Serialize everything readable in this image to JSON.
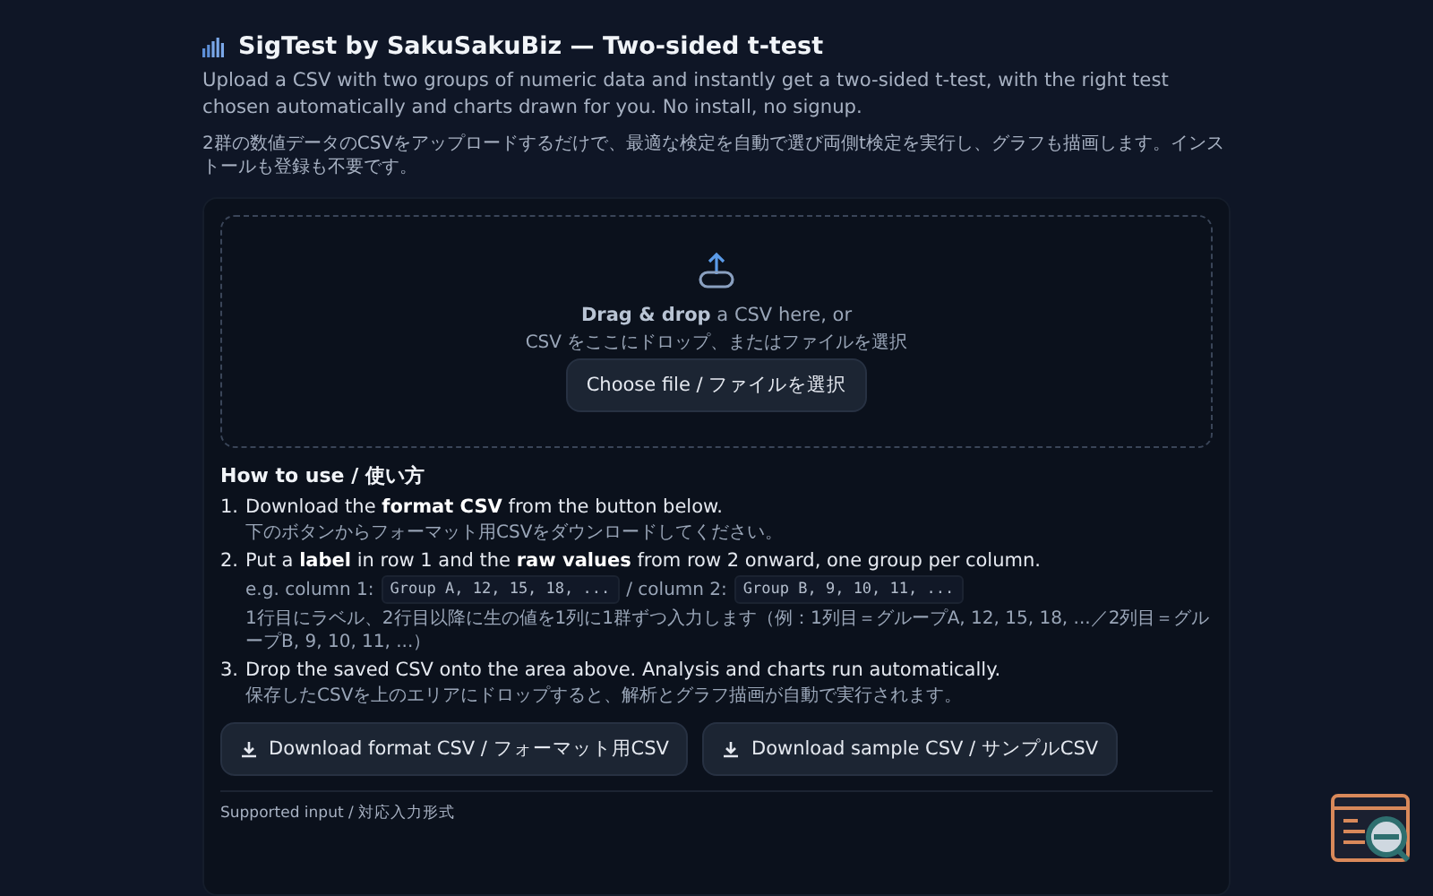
{
  "header": {
    "title": "SigTest by SakuSakuBiz — Two-sided t-test",
    "description": "Upload a CSV with two groups of numeric data and instantly get a two-sided t-test, with the right test chosen automatically and charts drawn for you. No install, no signup.",
    "description_ja": "2群の数値データのCSVをアップロードするだけで、最適な検定を自動で選び両側t検定を実行し、グラフも描画します。インストールも登録も不要です。"
  },
  "dropzone": {
    "prompt": "**Drag & drop** a CSV here, or",
    "prompt_ja": "CSV をここにドロップ、またはファイルを選択",
    "button": "Choose file / ファイルを選択"
  },
  "how_to": {
    "title": "How to use / 使い方",
    "steps": [
      {
        "number": "1.",
        "text": "Download the **format CSV** from the button below.",
        "note": "下のボタンからフォーマット用CSVをダウンロードしてください。"
      },
      {
        "number": "2.",
        "text": "Put a **label** in row 1 and the **raw values** from row 2 onward, one group per column.",
        "example": [
          {
            "label": "e.g. column 1:",
            "code": "Group A, 12, 15, 18, ..."
          },
          {
            "label": "/ column 2:",
            "code": "Group B, 9, 10, 11, ..."
          }
        ],
        "note": "1行目にラベル、2行目以降に生の値を1列に1群ずつ入力します（例：1列目＝グループA, 12, 15, 18, ...／2列目＝グループB, 9, 10, 11, ...）"
      },
      {
        "number": "3.",
        "text": "Drop the saved CSV onto the area above. Analysis and charts run automatically.",
        "note": "保存したCSVを上のエリアにドロップすると、解析とグラフ描画が自動で実行されます。"
      }
    ]
  },
  "downloads": [
    "Download format CSV / フォーマット用CSV",
    "Download sample CSV / サンプルCSV"
  ],
  "footer": {
    "label": "Supported input / 対応入力形式"
  }
}
